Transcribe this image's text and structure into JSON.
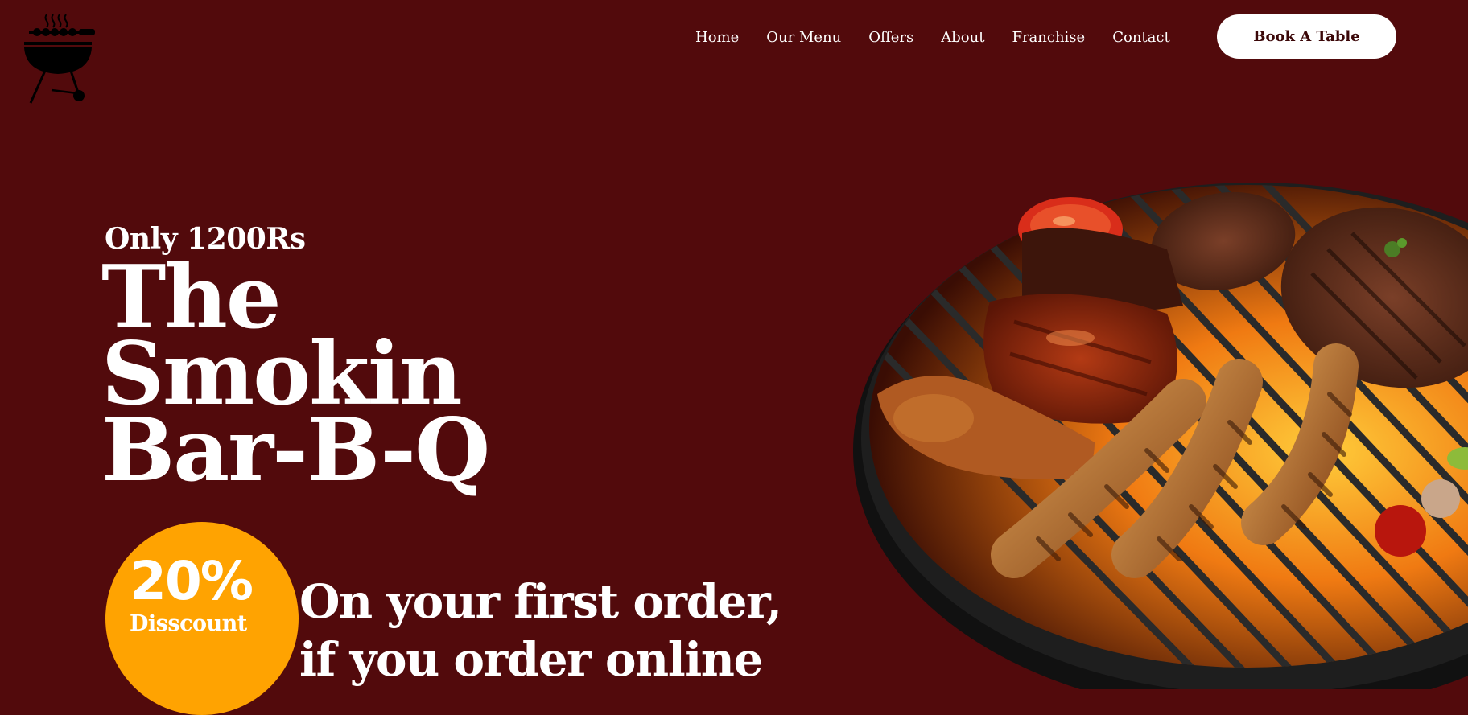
{
  "nav": {
    "links": [
      "Home",
      "Our Menu",
      "Offers",
      "About",
      "Franchise",
      "Contact"
    ],
    "cta": "Book A Table"
  },
  "hero": {
    "price_tag": "Only 1200Rs",
    "title_lines": [
      "The",
      "Smokin",
      "Bar-B-Q"
    ]
  },
  "discount": {
    "percent": "20%",
    "word": "Disscount",
    "offer_lines": [
      "On your first order,",
      "if you order online"
    ]
  },
  "icons": {
    "logo": "bbq-grill-icon",
    "hero_image": "grilled-meats-image"
  },
  "colors": {
    "background": "#520a0c",
    "accent": "#ffa301",
    "button_bg": "#ffffff",
    "button_text": "#3b0708"
  }
}
